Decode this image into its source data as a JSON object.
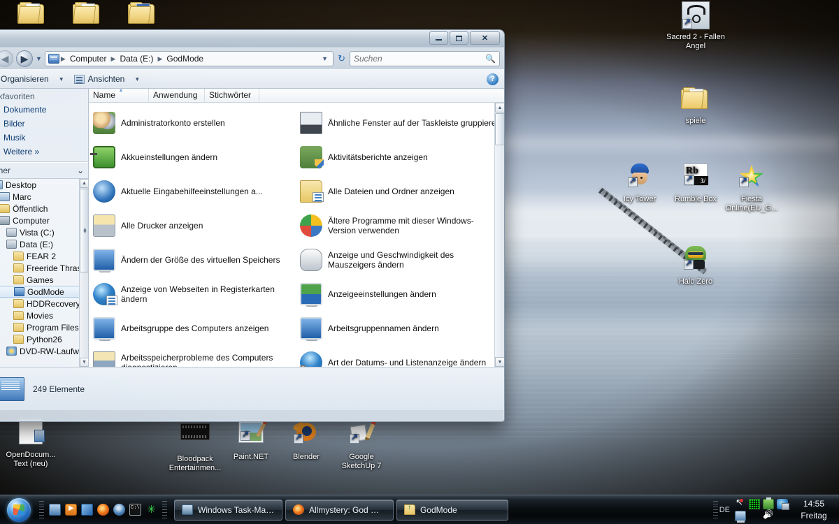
{
  "window": {
    "title": "GodMode",
    "controls": {
      "minimize": "Minimieren",
      "maximize": "Maximieren",
      "close": "Schließen"
    },
    "nav": {
      "back": "Zurück",
      "forward": "Vorwärts",
      "history_dropdown": "Letzte Orte"
    },
    "breadcrumb": [
      "Computer",
      "Data (E:)",
      "GodMode"
    ],
    "refresh_label": "Aktualisieren",
    "search": {
      "placeholder": "Suchen",
      "value": ""
    },
    "toolbar": {
      "organize": "Organisieren",
      "views": "Ansichten",
      "help": "?"
    },
    "columns": [
      "Name",
      "Anwendung",
      "Stichwörter"
    ],
    "sort_column": "Name",
    "status": {
      "count_text": "249 Elemente"
    }
  },
  "navpane": {
    "favorites_header": "nkfavoriten",
    "favorites": [
      "Dokumente",
      "Bilder",
      "Musik"
    ],
    "more_label": "Weitere",
    "folders_label": "rdner",
    "tree": [
      {
        "label": "Desktop",
        "icon": "monitor-icon",
        "indent": 0,
        "selected": false
      },
      {
        "label": "Marc",
        "icon": "user-icon",
        "indent": 1,
        "selected": false
      },
      {
        "label": "Öffentlich",
        "icon": "folder-icon",
        "indent": 1,
        "selected": false
      },
      {
        "label": "Computer",
        "icon": "computer-icon",
        "indent": 1,
        "selected": false
      },
      {
        "label": "Vista (C:)",
        "icon": "disk-icon",
        "indent": 2,
        "selected": false
      },
      {
        "label": "Data (E:)",
        "icon": "disk-icon",
        "indent": 2,
        "selected": false
      },
      {
        "label": "FEAR 2",
        "icon": "folder-icon",
        "indent": 3,
        "selected": false
      },
      {
        "label": "Freeride Thrash",
        "icon": "folder-icon",
        "indent": 3,
        "selected": false
      },
      {
        "label": "Games",
        "icon": "folder-icon",
        "indent": 3,
        "selected": false
      },
      {
        "label": "GodMode",
        "icon": "godmode-icon",
        "indent": 3,
        "selected": true
      },
      {
        "label": "HDDRecovery",
        "icon": "folder-icon",
        "indent": 3,
        "selected": false
      },
      {
        "label": "Movies",
        "icon": "folder-icon",
        "indent": 3,
        "selected": false
      },
      {
        "label": "Program Files",
        "icon": "folder-icon",
        "indent": 3,
        "selected": false
      },
      {
        "label": "Python26",
        "icon": "folder-icon",
        "indent": 3,
        "selected": false
      },
      {
        "label": "DVD-RW-Laufwer",
        "icon": "dvd-icon",
        "indent": 2,
        "selected": false
      }
    ]
  },
  "items": [
    {
      "label": "Administratorkonto erstellen",
      "icon": "users-icon"
    },
    {
      "label": "Ähnliche Fenster auf der Taskleiste gruppieren",
      "icon": "server-taskbar-icon"
    },
    {
      "label": "Akkueinstellungen ändern",
      "icon": "battery-icon"
    },
    {
      "label": "Aktivitätsberichte anzeigen",
      "icon": "parental-controls-icon"
    },
    {
      "label": "Aktuelle Eingabehilfeeinstellungen a...",
      "icon": "accessibility-icon"
    },
    {
      "label": "Alle Dateien und Ordner anzeigen",
      "icon": "folder-options-icon"
    },
    {
      "label": "Alle Drucker anzeigen",
      "icon": "printer-folder-icon"
    },
    {
      "label": "Ältere Programme mit dieser Windows-Version verwenden",
      "icon": "compatibility-icon"
    },
    {
      "label": "Ändern der Größe des virtuellen Speichers",
      "icon": "system-monitor-icon"
    },
    {
      "label": "Anzeige und Geschwindigkeit des Mauszeigers ändern",
      "icon": "mouse-icon"
    },
    {
      "label": "Anzeige von Webseiten in Registerkarten ändern",
      "icon": "internet-options-icon"
    },
    {
      "label": "Anzeigeeinstellungen ändern",
      "icon": "display-settings-icon"
    },
    {
      "label": "Arbeitsgruppe des Computers anzeigen",
      "icon": "system-monitor-icon"
    },
    {
      "label": "Arbeitsgruppennamen ändern",
      "icon": "system-monitor-icon"
    },
    {
      "label": "Arbeitsspeicherprobleme des Computers diagnostizieren",
      "icon": "memory-diagnostic-icon"
    },
    {
      "label": "Art der Datums- und Listenanzeige ändern",
      "icon": "region-clock-icon"
    }
  ],
  "desktop": {
    "icons_top_left": [
      {
        "label": "",
        "icon": "folder-icon"
      },
      {
        "label": "",
        "icon": "folder-icon"
      },
      {
        "label": "",
        "icon": "folder-icon"
      }
    ],
    "icons_right": [
      {
        "label": "Sacred 2 - Fallen Angel",
        "icon": "sacred2-shortcut-icon"
      },
      {
        "label": "spiele",
        "icon": "folder-icon"
      },
      {
        "label": "Icy Tower",
        "icon": "icytower-shortcut-icon"
      },
      {
        "label": "Rumble Box",
        "icon": "rumblebox-shortcut-icon"
      },
      {
        "label": "Fiesta Online(EU_G...",
        "icon": "fiesta-shortcut-icon"
      },
      {
        "label": "Halo Zero",
        "icon": "halozero-shortcut-icon"
      }
    ],
    "icons_bottom": [
      {
        "label": "OpenDocum... Text (neu)",
        "icon": "opendocument-text-icon"
      },
      {
        "label": "Bloodpack Entertainmen...",
        "icon": "bloodpack-icon"
      },
      {
        "label": "Paint.NET",
        "icon": "paintnet-shortcut-icon"
      },
      {
        "label": "Blender",
        "icon": "blender-shortcut-icon"
      },
      {
        "label": "Google SketchUp 7",
        "icon": "sketchup-shortcut-icon"
      }
    ]
  },
  "taskbar": {
    "start_label": "Start",
    "quicklaunch": [
      {
        "name": "show-desktop-icon"
      },
      {
        "name": "windows-media-player-icon"
      },
      {
        "name": "flip3d-icon"
      },
      {
        "name": "firefox-icon"
      },
      {
        "name": "miranda-im-icon"
      },
      {
        "name": "command-prompt-icon"
      },
      {
        "name": "asterisk-icon"
      }
    ],
    "tasks": [
      {
        "label": "Windows Task-Man...",
        "icon": "task-manager-icon"
      },
      {
        "label": "Allmystery: God Mo...",
        "icon": "firefox-icon"
      },
      {
        "label": "GodMode",
        "icon": "folder-icon"
      }
    ],
    "tray": {
      "language": "DE",
      "icons": [
        "cursor-icon",
        "green-grid-icon",
        "battery-icon",
        "network-icon",
        "monitor-icon",
        "volume-icon"
      ],
      "time": "14:55",
      "day": "Freitag"
    }
  }
}
